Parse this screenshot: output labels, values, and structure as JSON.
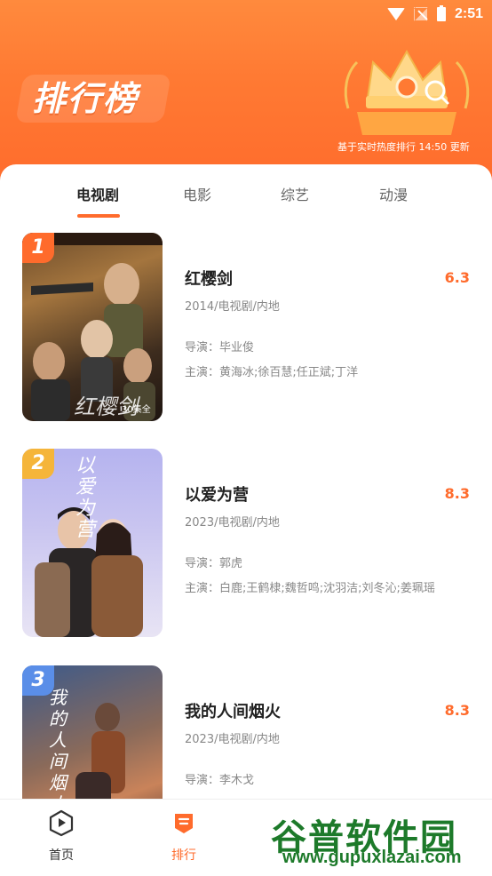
{
  "status_bar": {
    "time": "2:51"
  },
  "header": {
    "title": "排行榜",
    "update_note": "基于实时热度排行 14:50 更新"
  },
  "tabs": [
    {
      "label": "电视剧",
      "active": true
    },
    {
      "label": "电影",
      "active": false
    },
    {
      "label": "综艺",
      "active": false
    },
    {
      "label": "动漫",
      "active": false
    }
  ],
  "items": [
    {
      "rank": "1",
      "rank_color": "#ff6b2c",
      "poster_text": "红樱剑",
      "poster_badge": "30集全",
      "title": "红樱剑",
      "score": "6.3",
      "meta": "2014/电视剧/内地",
      "director": "导演：毕业俊",
      "cast": "主演：黄海冰;徐百慧;任正斌;丁洋"
    },
    {
      "rank": "2",
      "rank_color": "#f5b53a",
      "poster_text": "以爱为营",
      "title": "以爱为营",
      "score": "8.3",
      "meta": "2023/电视剧/内地",
      "director": "导演：郭虎",
      "cast": "主演：白鹿;王鹤棣;魏哲鸣;沈羽洁;刘冬沁;姜珮瑶"
    },
    {
      "rank": "3",
      "rank_color": "#5a8ee8",
      "poster_text": "我的人间烟火",
      "title": "我的人间烟火",
      "score": "8.3",
      "meta": "2023/电视剧/内地",
      "director": "导演：李木戈",
      "cast": ""
    }
  ],
  "nav": [
    {
      "label": "首页",
      "icon": "play-icon",
      "active": false
    },
    {
      "label": "排行",
      "icon": "ranking-icon",
      "active": true
    },
    {
      "label": "",
      "icon": "",
      "active": false
    },
    {
      "label": "",
      "icon": "",
      "active": false
    }
  ],
  "watermark": {
    "text": "谷普软件园",
    "url": "www.gupuxlazai.com"
  },
  "colors": {
    "accent": "#ff6b2c",
    "header_top": "#ff8a3d"
  }
}
